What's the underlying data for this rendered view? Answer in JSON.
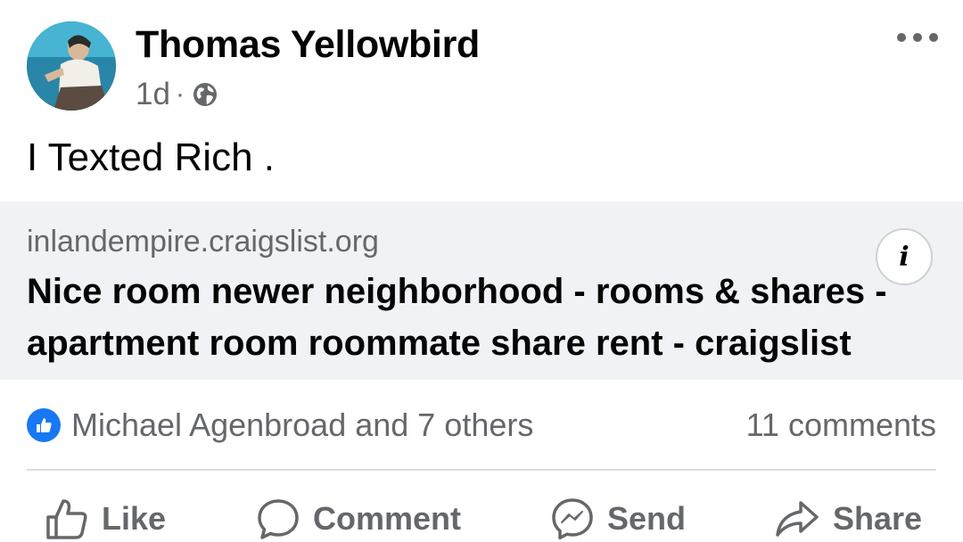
{
  "post": {
    "author": "Thomas Yellowbird",
    "time": "1d",
    "separator": "·",
    "audience_icon": "globe-icon",
    "text": "I Texted Rich ."
  },
  "link_preview": {
    "domain": "inlandempire.craigslist.org",
    "title": "Nice room newer neighborhood - rooms & shares - apartment room roommate share rent - craigslist",
    "info_label": "i"
  },
  "reactions": {
    "summary": "Michael Agenbroad and 7 others",
    "comments": "11 comments"
  },
  "actions": [
    {
      "label": "Like",
      "icon": "thumbs-up-icon"
    },
    {
      "label": "Comment",
      "icon": "speech-bubble-icon"
    },
    {
      "label": "Send",
      "icon": "messenger-icon"
    },
    {
      "label": "Share",
      "icon": "share-arrow-icon"
    }
  ],
  "colors": {
    "text_primary": "#050505",
    "text_secondary": "#65676b",
    "preview_bg": "#f0f2f5",
    "like_blue": "#1877f2"
  }
}
